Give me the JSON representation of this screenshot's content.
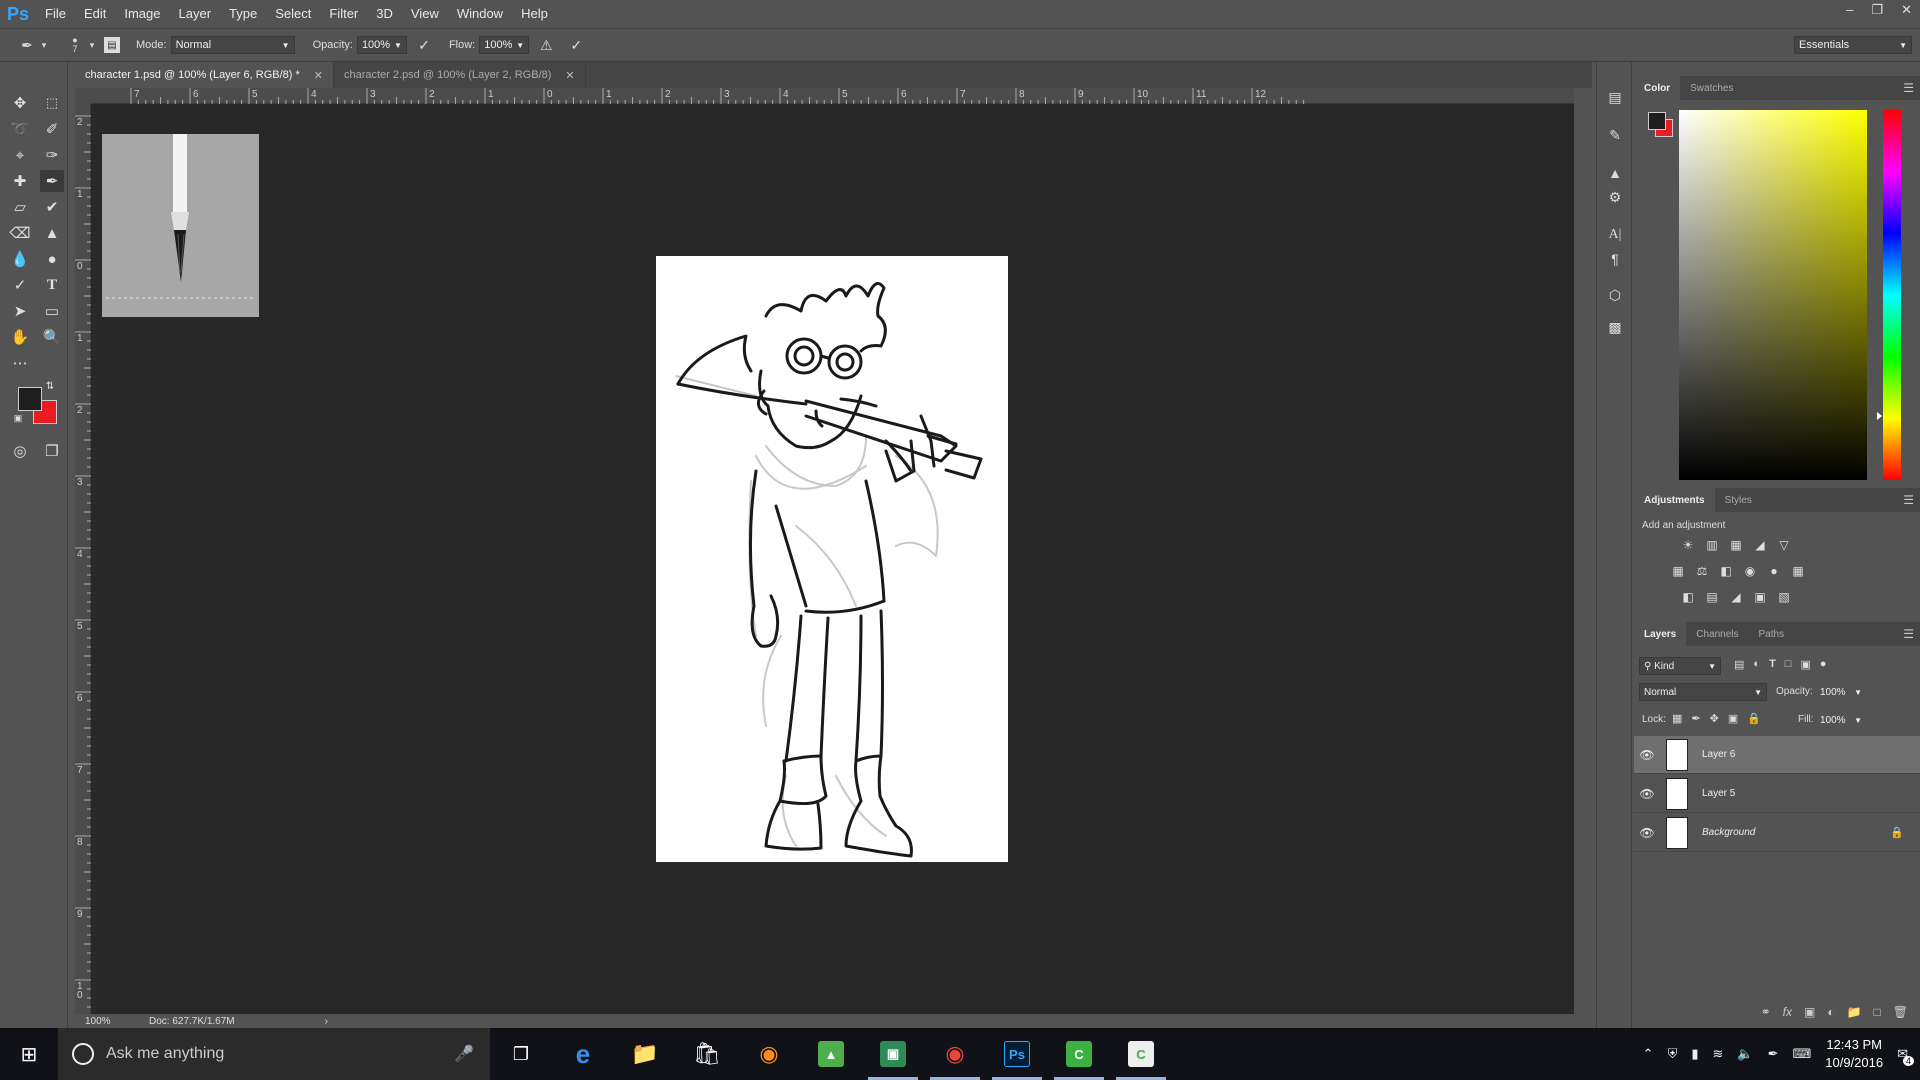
{
  "app": {
    "logo": "Ps"
  },
  "menu": [
    "File",
    "Edit",
    "Image",
    "Layer",
    "Type",
    "Select",
    "Filter",
    "3D",
    "View",
    "Window",
    "Help"
  ],
  "options": {
    "brush_size": "7",
    "mode_label": "Mode:",
    "mode_value": "Normal",
    "opacity_label": "Opacity:",
    "opacity_value": "100%",
    "flow_label": "Flow:",
    "flow_value": "100%",
    "workspace": "Essentials"
  },
  "documents": {
    "tabs": [
      {
        "label": "character 1.psd @ 100% (Layer 6, RGB/8) *",
        "active": true
      },
      {
        "label": "character 2.psd @ 100% (Layer 2, RGB/8)",
        "active": false
      }
    ],
    "ruler_h": [
      "7",
      "6",
      "5",
      "4",
      "3",
      "2",
      "1",
      "0",
      "1",
      "2",
      "3",
      "4",
      "5",
      "6",
      "7",
      "8",
      "9",
      "10",
      "11",
      "12"
    ],
    "ruler_v": [
      "2",
      "1",
      "0",
      "1",
      "2",
      "3",
      "4",
      "5",
      "6",
      "7",
      "8",
      "9",
      "10"
    ]
  },
  "status": {
    "zoom": "100%",
    "doc": "Doc: 627.7K/1.67M"
  },
  "colors": {
    "foreground": "#1e1e1e",
    "background": "#e91b23"
  },
  "panels": {
    "color_tabs": [
      "Color",
      "Swatches"
    ],
    "adjustments_tabs": [
      "Adjustments",
      "Styles"
    ],
    "adjustments_title": "Add an adjustment",
    "layers_tabs": [
      "Layers",
      "Channels",
      "Paths"
    ],
    "layers_filter": "Kind",
    "blend_mode": "Normal",
    "opacity_label": "Opacity:",
    "opacity_value": "100%",
    "lock_label": "Lock:",
    "fill_label": "Fill:",
    "fill_value": "100%",
    "layers": [
      {
        "name": "Layer 6",
        "selected": true
      },
      {
        "name": "Layer 5",
        "selected": false
      },
      {
        "name": "Background",
        "selected": false,
        "locked": true
      }
    ]
  },
  "taskbar": {
    "search_placeholder": "Ask me anything",
    "time": "12:43 PM",
    "date": "10/9/2016",
    "notification_count": "4"
  }
}
